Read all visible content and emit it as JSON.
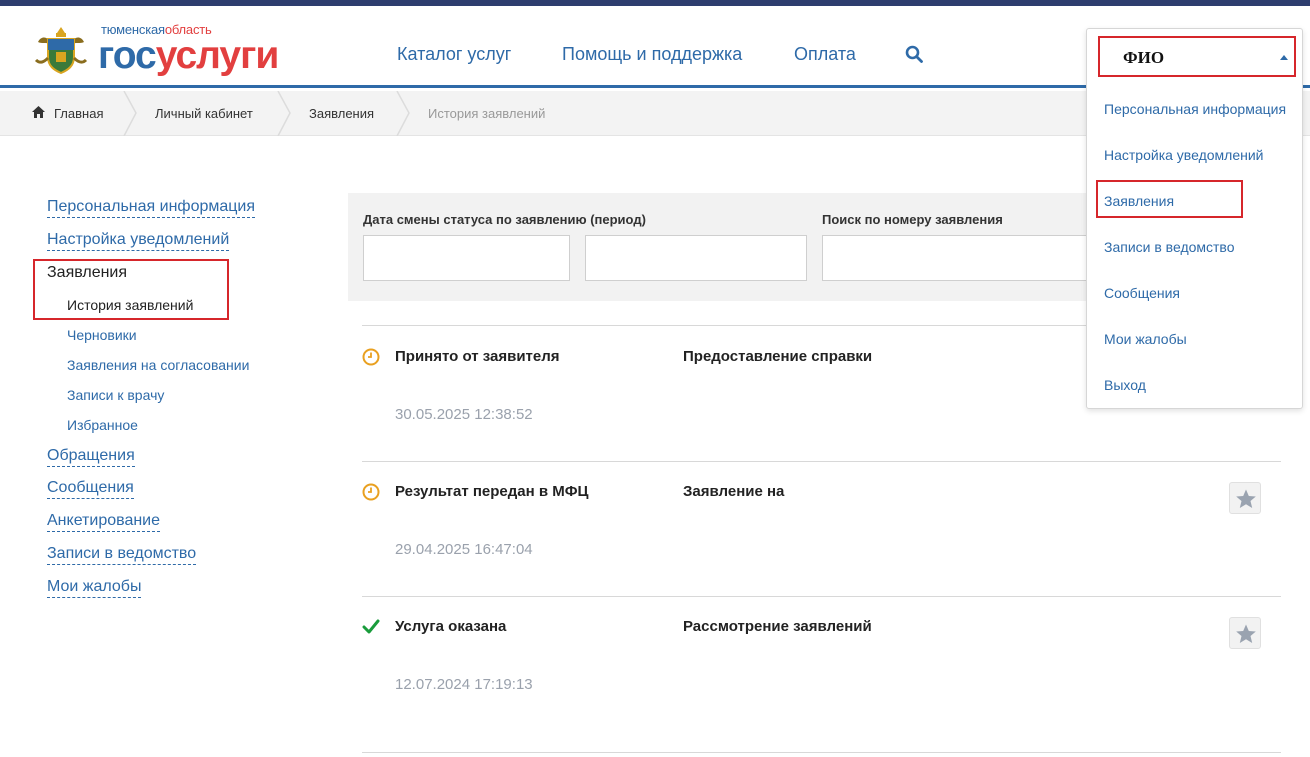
{
  "logo": {
    "region_prefix": "тюменская",
    "region_suffix": "область",
    "brand_gos": "гос",
    "brand_uslugi": "услуги"
  },
  "nav": {
    "catalog": "Каталог услуг",
    "help": "Помощь и поддержка",
    "payment": "Оплата",
    "search_icon": "search-icon"
  },
  "breadcrumb": {
    "home": "Главная",
    "cabinet": "Личный кабинет",
    "applications": "Заявления",
    "current": "История заявлений"
  },
  "sidebar": {
    "personal": "Персональная информация",
    "notifications": "Настройка уведомлений",
    "applications": "Заявления",
    "history": "История заявлений",
    "drafts": "Черновики",
    "approval": "Заявления на согласовании",
    "doctor": "Записи к врачу",
    "favorites": "Избранное",
    "appeals": "Обращения",
    "messages": "Сообщения",
    "survey": "Анкетирование",
    "department": "Записи в ведомство",
    "complaints": "Мои жалобы"
  },
  "filter": {
    "date_label": "Дата смены статуса по заявлению (период)",
    "search_label": "Поиск по номеру заявления",
    "date_from": "",
    "date_to": "",
    "search_value": ""
  },
  "applications": [
    {
      "status": "Принято от заявителя",
      "service": "Предоставление справки",
      "date": "30.05.2025 12:38:52",
      "icon": "clock-icon",
      "favorite_shown": false
    },
    {
      "status": "Результат передан в МФЦ",
      "service": "Заявление на",
      "date": "29.04.2025 16:47:04",
      "icon": "clock-icon",
      "favorite_shown": true
    },
    {
      "status": "Услуга оказана",
      "service": "Рассмотрение заявлений",
      "date": "12.07.2024 17:19:13",
      "icon": "check-icon",
      "favorite_shown": true
    }
  ],
  "user_menu": {
    "name": "ФИО",
    "items": [
      "Персональная информация",
      "Настройка уведомлений",
      "Заявления",
      "Записи в ведомство",
      "Сообщения",
      "Мои жалобы",
      "Выход"
    ]
  },
  "colors": {
    "brand_blue": "#2e6aa8",
    "brand_red": "#e23f3f",
    "highlight_red": "#d6262b",
    "clock_orange": "#e9a020",
    "check_green": "#1a9c3c"
  }
}
